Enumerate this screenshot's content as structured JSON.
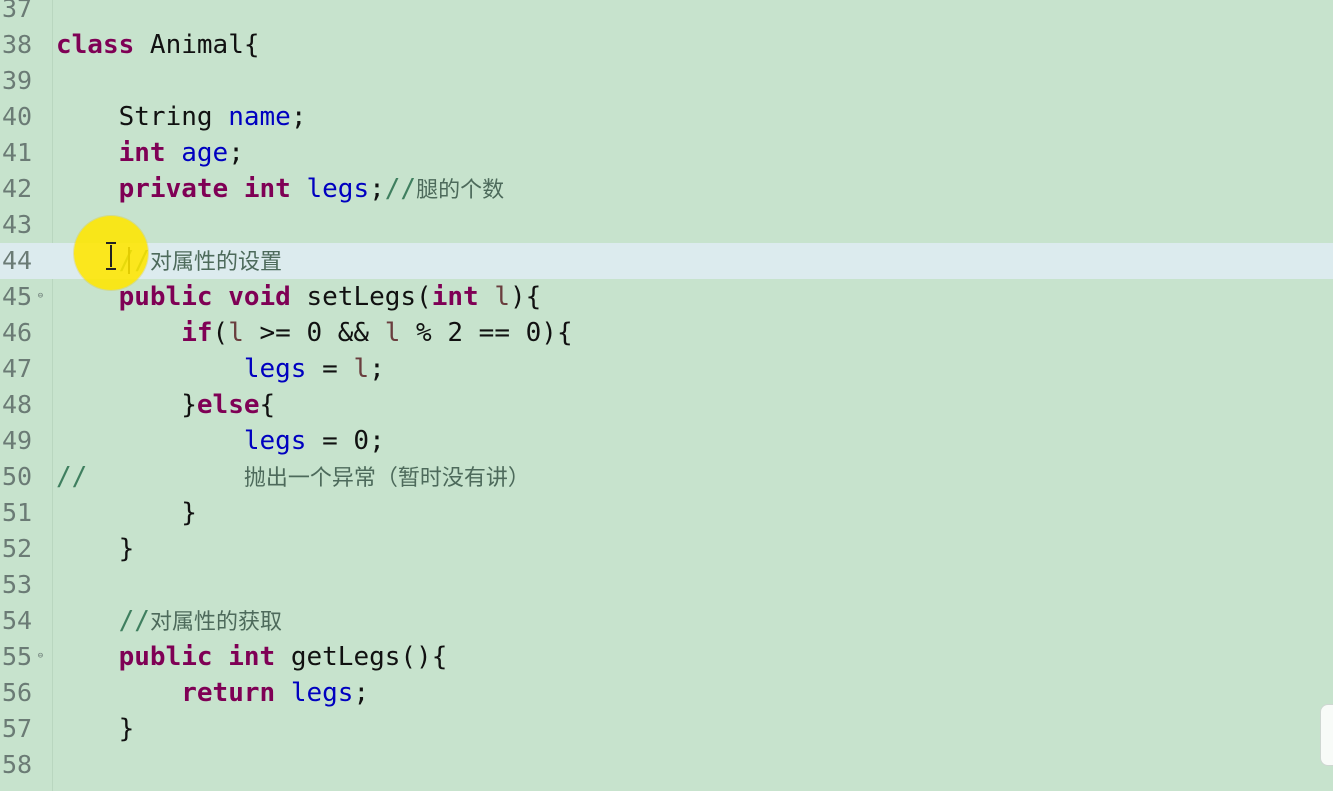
{
  "editor": {
    "lines": [
      {
        "number": "37",
        "tokens": []
      },
      {
        "number": "38",
        "tokens": [
          {
            "text": "class",
            "type": "kw"
          },
          {
            "text": " Animal{",
            "type": "plain"
          }
        ]
      },
      {
        "number": "39",
        "tokens": []
      },
      {
        "number": "40",
        "tokens": [
          {
            "text": "    String ",
            "type": "plain"
          },
          {
            "text": "name",
            "type": "fld"
          },
          {
            "text": ";",
            "type": "plain"
          }
        ]
      },
      {
        "number": "41",
        "tokens": [
          {
            "text": "    ",
            "type": "plain"
          },
          {
            "text": "int",
            "type": "kw"
          },
          {
            "text": " ",
            "type": "plain"
          },
          {
            "text": "age",
            "type": "fld"
          },
          {
            "text": ";",
            "type": "plain"
          }
        ]
      },
      {
        "number": "42",
        "tokens": [
          {
            "text": "    ",
            "type": "plain"
          },
          {
            "text": "private",
            "type": "kw"
          },
          {
            "text": " ",
            "type": "plain"
          },
          {
            "text": "int",
            "type": "kw"
          },
          {
            "text": " ",
            "type": "plain"
          },
          {
            "text": "legs",
            "type": "fld"
          },
          {
            "text": ";",
            "type": "plain"
          },
          {
            "text": "//",
            "type": "cmt"
          },
          {
            "text": "腿的个数",
            "type": "cmt-cn"
          }
        ]
      },
      {
        "number": "43",
        "tokens": []
      },
      {
        "number": "44",
        "current": true,
        "tokens": [
          {
            "text": "    ",
            "type": "plain"
          },
          {
            "text": "//",
            "type": "cmt"
          },
          {
            "text": "对属性的设置",
            "type": "cmt-cn"
          }
        ]
      },
      {
        "number": "45",
        "fold": "⊖",
        "tokens": [
          {
            "text": "    ",
            "type": "plain"
          },
          {
            "text": "public",
            "type": "kw"
          },
          {
            "text": " ",
            "type": "plain"
          },
          {
            "text": "void",
            "type": "kw"
          },
          {
            "text": " setLegs(",
            "type": "plain"
          },
          {
            "text": "int",
            "type": "kw"
          },
          {
            "text": " ",
            "type": "plain"
          },
          {
            "text": "l",
            "type": "var"
          },
          {
            "text": "){",
            "type": "plain"
          }
        ]
      },
      {
        "number": "46",
        "tokens": [
          {
            "text": "        ",
            "type": "plain"
          },
          {
            "text": "if",
            "type": "kw"
          },
          {
            "text": "(",
            "type": "plain"
          },
          {
            "text": "l",
            "type": "var"
          },
          {
            "text": " >= 0 && ",
            "type": "plain"
          },
          {
            "text": "l",
            "type": "var"
          },
          {
            "text": " % 2 == 0){",
            "type": "plain"
          }
        ]
      },
      {
        "number": "47",
        "tokens": [
          {
            "text": "            ",
            "type": "plain"
          },
          {
            "text": "legs",
            "type": "fld"
          },
          {
            "text": " = ",
            "type": "plain"
          },
          {
            "text": "l",
            "type": "var"
          },
          {
            "text": ";",
            "type": "plain"
          }
        ]
      },
      {
        "number": "48",
        "tokens": [
          {
            "text": "        }",
            "type": "plain"
          },
          {
            "text": "else",
            "type": "kw"
          },
          {
            "text": "{",
            "type": "plain"
          }
        ]
      },
      {
        "number": "49",
        "tokens": [
          {
            "text": "            ",
            "type": "plain"
          },
          {
            "text": "legs",
            "type": "fld"
          },
          {
            "text": " = 0;",
            "type": "plain"
          }
        ]
      },
      {
        "number": "50",
        "tokens": [
          {
            "text": "//",
            "type": "cmt"
          },
          {
            "text": "          ",
            "type": "plain"
          },
          {
            "text": "抛出一个异常（暂时没有讲）",
            "type": "cmt-cn"
          }
        ]
      },
      {
        "number": "51",
        "tokens": [
          {
            "text": "        }",
            "type": "plain"
          }
        ]
      },
      {
        "number": "52",
        "tokens": [
          {
            "text": "    }",
            "type": "plain"
          }
        ]
      },
      {
        "number": "53",
        "tokens": []
      },
      {
        "number": "54",
        "tokens": [
          {
            "text": "    ",
            "type": "plain"
          },
          {
            "text": "//",
            "type": "cmt"
          },
          {
            "text": "对属性的获取",
            "type": "cmt-cn"
          }
        ]
      },
      {
        "number": "55",
        "fold": "⊖",
        "tokens": [
          {
            "text": "    ",
            "type": "plain"
          },
          {
            "text": "public",
            "type": "kw"
          },
          {
            "text": " ",
            "type": "plain"
          },
          {
            "text": "int",
            "type": "kw"
          },
          {
            "text": " getLegs(){",
            "type": "plain"
          }
        ]
      },
      {
        "number": "56",
        "tokens": [
          {
            "text": "        ",
            "type": "plain"
          },
          {
            "text": "return",
            "type": "kw"
          },
          {
            "text": " ",
            "type": "plain"
          },
          {
            "text": "legs",
            "type": "fld"
          },
          {
            "text": ";",
            "type": "plain"
          }
        ]
      },
      {
        "number": "57",
        "tokens": [
          {
            "text": "    }",
            "type": "plain"
          }
        ]
      },
      {
        "number": "58",
        "tokens": []
      }
    ]
  },
  "colors": {
    "editor_background": "#c7e3cd",
    "current_line": "#dcebee",
    "keyword": "#7f0055",
    "field": "#0000c0",
    "comment": "#3f7f5f",
    "cursor_highlight": "#ffe600"
  },
  "pointer": {
    "icon": "i-beam-cursor-icon"
  }
}
